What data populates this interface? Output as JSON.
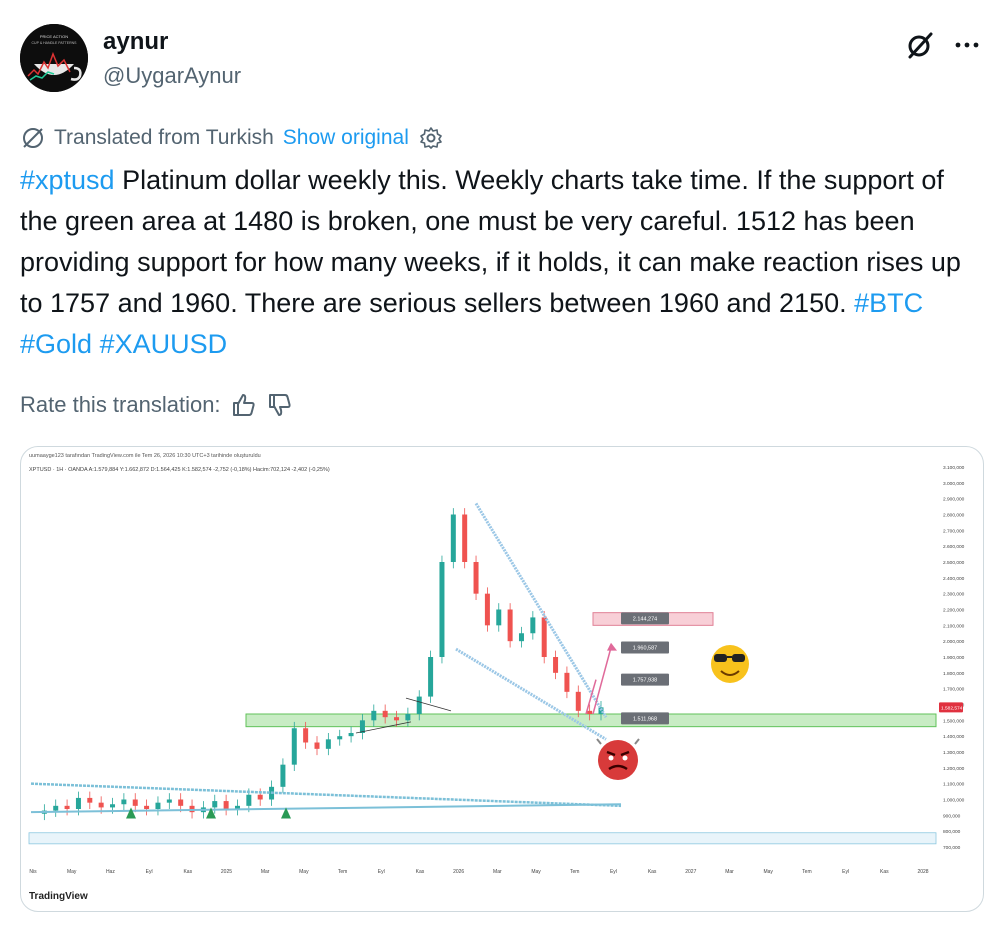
{
  "author": {
    "name": "aynur",
    "handle": "@UygarAynur",
    "avatar_text_line1": "PRICE ACTION",
    "avatar_text_line2": "CUP & HANDLE PATTERNS"
  },
  "icons": {
    "grok": "grok-icon",
    "more": "more-icon",
    "translate": "translate-icon",
    "settings": "gear-icon",
    "thumbs_up": "thumbs-up-icon",
    "thumbs_down": "thumbs-down-icon"
  },
  "translation": {
    "label": "Translated from Turkish",
    "show_original": "Show original",
    "rate_label": "Rate this translation:"
  },
  "tweet": {
    "tag_start": "#xptusd",
    "body": " Platinum dollar weekly this. Weekly charts take time. If the support of the green area at 1480 is broken, one must be very careful. 1512 has been providing support for how many weeks, if it holds, it can make reaction rises up to 1757 and 1960. There are serious sellers between 1960 and 2150. ",
    "tags_end": [
      "#BTC",
      "#Gold",
      "#XAUUSD"
    ]
  },
  "chart_data": {
    "type": "line",
    "header_line": "uumaayge123 tarafından TradingView.com ile Tem 26, 2026 10:30 UTC+3 tarihinde oluşturuldu",
    "symbol_line": "XPTUSD · 1H · OANDA  A:1.579,884  Y:1.662,872  D:1.564,425  K:1.582,574  -2,752 (-0,18%)  Hacim:702,124  -2,402 (-0,25%)",
    "watermark": "TradingView",
    "y_ticks": [
      "3.100,000",
      "3.000,000",
      "2.900,000",
      "2.800,000",
      "2.700,000",
      "2.600,000",
      "2.500,000",
      "2.400,000",
      "2.300,000",
      "2.200,000",
      "2.100,000",
      "2.000,000",
      "1.900,000",
      "1.800,000",
      "1.700,000",
      "1.600,000",
      "1.500,000",
      "1.400,000",
      "1.300,000",
      "1.200,000",
      "1.100,000",
      "1.000,000",
      "900,000",
      "800,000",
      "700,000"
    ],
    "x_ticks": [
      "Nis",
      "May",
      "Haz",
      "Eyl",
      "Kas",
      "2025",
      "Mar",
      "May",
      "Tem",
      "Eyl",
      "Kas",
      "2026",
      "Mar",
      "May",
      "Tem",
      "Eyl",
      "Kas",
      "2027",
      "Mar",
      "May",
      "Tem",
      "Eyl",
      "Kas",
      "2028"
    ],
    "price_labels": [
      "2.144,274",
      "1.960,587",
      "1.757,938",
      "1.511,968"
    ],
    "last_price_label": "1.582,574",
    "ylim": [
      700,
      3100
    ],
    "series": [
      {
        "values": [
          910,
          930,
          960,
          940,
          1010,
          980,
          950,
          970,
          1000,
          960,
          940,
          980,
          1000,
          960,
          920,
          950,
          990,
          940,
          960,
          1030,
          1000,
          1080,
          1220,
          1450,
          1360,
          1320,
          1380,
          1400,
          1420,
          1500,
          1560,
          1520,
          1500,
          1540,
          1650,
          1900,
          2500,
          2800,
          2500,
          2300,
          2100,
          2200,
          2000,
          2050,
          2150,
          1900,
          1800,
          1680,
          1560,
          1540,
          1582
        ]
      }
    ]
  }
}
